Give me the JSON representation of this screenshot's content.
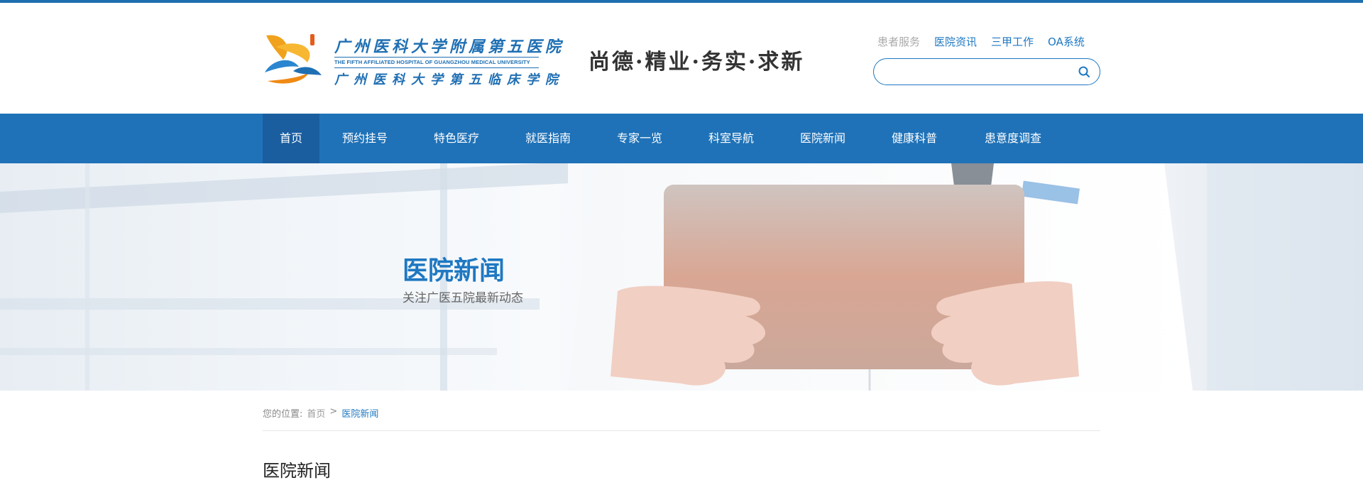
{
  "brand": {
    "name_cn": "广州医科大学附属第五医院",
    "name_en": "THE FIFTH AFFILIATED HOSPITAL OF GUANGZHOU MEDICAL UNIVERSITY",
    "subtitle_cn": "广州医科大学第五临床学院",
    "motto": "尚德·精业·务实·求新",
    "logo_icon": "hospital-logo-icon",
    "accent_color": "#1f72b8"
  },
  "quick_links": {
    "patient_service": "患者服务",
    "hospital_news": "医院资讯",
    "grade_a": "三甲工作",
    "oa": "OA系统"
  },
  "search": {
    "value": "",
    "placeholder": "",
    "icon": "search-icon"
  },
  "nav": {
    "items": [
      {
        "label": "首页"
      },
      {
        "label": "预约挂号"
      },
      {
        "label": "特色医疗"
      },
      {
        "label": "就医指南"
      },
      {
        "label": "专家一览"
      },
      {
        "label": "科室导航"
      },
      {
        "label": "医院新闻"
      },
      {
        "label": "健康科普"
      },
      {
        "label": "患意度调查"
      }
    ],
    "active_index": 0
  },
  "banner": {
    "title": "医院新闻",
    "subtitle": "关注广医五院最新动态"
  },
  "breadcrumb": {
    "prefix": "您的位置:",
    "home": "首页",
    "separator": ">",
    "current": "医院新闻"
  },
  "section": {
    "title": "医院新闻"
  }
}
